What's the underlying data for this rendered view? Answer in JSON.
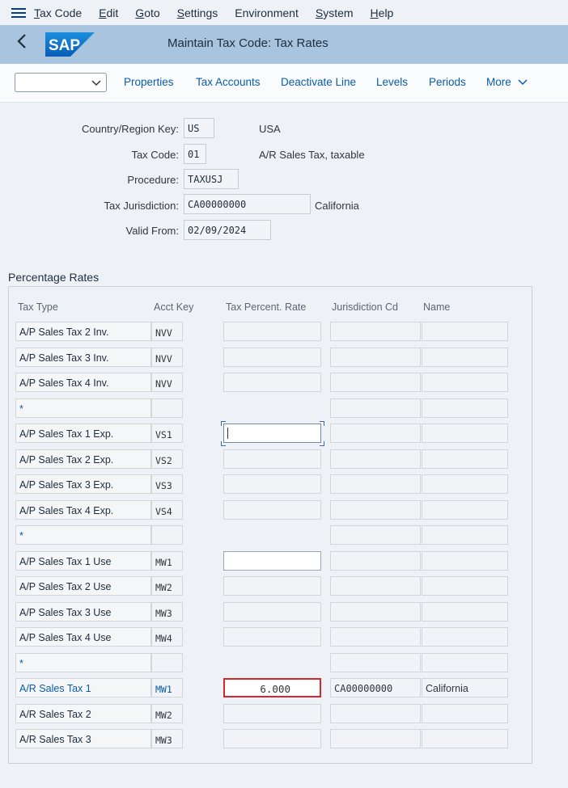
{
  "menu": {
    "items": [
      {
        "label": "Tax Code",
        "underline": "T",
        "rest": "ax Code"
      },
      {
        "label": "Edit",
        "underline": "E",
        "rest": "dit"
      },
      {
        "label": "Goto",
        "underline": "G",
        "rest": "oto"
      },
      {
        "label": "Settings",
        "underline": "S",
        "rest": "ettings"
      },
      {
        "label": "Environment",
        "underline": "",
        "rest": "Environment"
      },
      {
        "label": "System",
        "underline": "S",
        "rest": "ystem"
      },
      {
        "label": "Help",
        "underline": "H",
        "rest": "elp"
      }
    ]
  },
  "header": {
    "title": "Maintain Tax Code: Tax Rates",
    "logo_text": "SAP"
  },
  "toolbar": {
    "select_value": "",
    "buttons": [
      "Properties",
      "Tax Accounts",
      "Deactivate Line",
      "Levels",
      "Periods"
    ],
    "more_label": "More"
  },
  "form": {
    "country_label": "Country/Region Key:",
    "country_value": "US",
    "country_text": "USA",
    "taxcode_label": "Tax Code:",
    "taxcode_value": "01",
    "taxcode_text": "A/R Sales Tax, taxable",
    "procedure_label": "Procedure:",
    "procedure_value": "TAXUSJ",
    "jurisdiction_label": "Tax Jurisdiction:",
    "jurisdiction_value": "CA00000000",
    "jurisdiction_text": "California",
    "validfrom_label": "Valid From:",
    "validfrom_value": "02/09/2024"
  },
  "rates": {
    "section_title": "Percentage Rates",
    "columns": [
      "Tax Type",
      "Acct Key",
      "Tax Percent. Rate",
      "Jurisdiction Cd",
      "Name"
    ],
    "rows": [
      {
        "type": "A/P Sales Tax 2 Inv.",
        "key": "NVV",
        "rate": "",
        "rate_state": "disabled",
        "jur": "",
        "name": ""
      },
      {
        "type": "A/P Sales Tax 3 Inv.",
        "key": "NVV",
        "rate": "",
        "rate_state": "disabled",
        "jur": "",
        "name": ""
      },
      {
        "type": "A/P Sales Tax 4 Inv.",
        "key": "NVV",
        "rate": "",
        "rate_state": "disabled",
        "jur": "",
        "name": ""
      },
      {
        "type": "*",
        "key": "",
        "rate": "",
        "rate_state": "none",
        "jur": "",
        "name": ""
      },
      {
        "type": "A/P Sales Tax 1 Exp.",
        "key": "VS1",
        "rate": "",
        "rate_state": "focus",
        "jur": "",
        "name": ""
      },
      {
        "type": "A/P Sales Tax 2 Exp.",
        "key": "VS2",
        "rate": "",
        "rate_state": "disabled",
        "jur": "",
        "name": ""
      },
      {
        "type": "A/P Sales Tax 3 Exp.",
        "key": "VS3",
        "rate": "",
        "rate_state": "disabled",
        "jur": "",
        "name": ""
      },
      {
        "type": "A/P Sales Tax 4 Exp.",
        "key": "VS4",
        "rate": "",
        "rate_state": "disabled",
        "jur": "",
        "name": ""
      },
      {
        "type": "*",
        "key": "",
        "rate": "",
        "rate_state": "none",
        "jur": "",
        "name": ""
      },
      {
        "type": "A/P Sales Tax 1 Use",
        "key": "MW1",
        "rate": "",
        "rate_state": "white",
        "jur": "",
        "name": ""
      },
      {
        "type": "A/P Sales Tax 2 Use",
        "key": "MW2",
        "rate": "",
        "rate_state": "disabled",
        "jur": "",
        "name": ""
      },
      {
        "type": "A/P Sales Tax 3 Use",
        "key": "MW3",
        "rate": "",
        "rate_state": "disabled",
        "jur": "",
        "name": ""
      },
      {
        "type": "A/P Sales Tax 4 Use",
        "key": "MW4",
        "rate": "",
        "rate_state": "disabled",
        "jur": "",
        "name": ""
      },
      {
        "type": "*",
        "key": "",
        "rate": "",
        "rate_state": "none",
        "jur": "",
        "name": ""
      },
      {
        "type": "A/R Sales Tax 1",
        "key": "MW1",
        "rate": "6.000",
        "rate_state": "error",
        "jur": "CA00000000",
        "name": "California",
        "link": true
      },
      {
        "type": "A/R Sales Tax 2",
        "key": "MW2",
        "rate": "",
        "rate_state": "disabled",
        "jur": "",
        "name": ""
      },
      {
        "type": "A/R Sales Tax 3",
        "key": "MW3",
        "rate": "",
        "rate_state": "disabled",
        "jur": "",
        "name": ""
      }
    ]
  },
  "colors": {
    "title_bar": "#a9c4de",
    "link": "#0a5ca8",
    "error_border": "#d9262c",
    "sap_blue": "#0a6ed1"
  }
}
